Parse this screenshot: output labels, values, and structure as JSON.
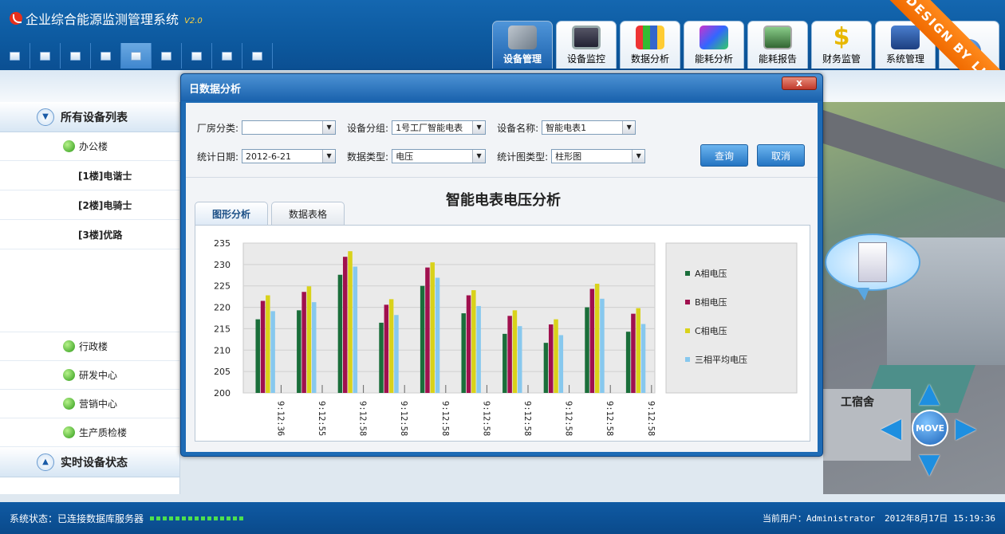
{
  "app": {
    "title": "企业综合能源监测管理系统",
    "version": "V2.0",
    "watermark": "DESIGN BY LJW"
  },
  "toolbar": {
    "buttons": [
      "toolbar-btn-1",
      "toolbar-btn-2",
      "toolbar-btn-3",
      "toolbar-btn-4",
      "toolbar-btn-5",
      "toolbar-btn-6",
      "toolbar-btn-7",
      "toolbar-btn-8",
      "toolbar-btn-9"
    ]
  },
  "nav": {
    "tabs": [
      {
        "label": "设备管理",
        "icon": "device-manage-icon",
        "active": true
      },
      {
        "label": "设备监控",
        "icon": "monitor-icon"
      },
      {
        "label": "数据分析",
        "icon": "data-analysis-icon"
      },
      {
        "label": "能耗分析",
        "icon": "energy-analysis-icon"
      },
      {
        "label": "能耗报告",
        "icon": "energy-report-icon"
      },
      {
        "label": "财务监管",
        "icon": "finance-icon"
      },
      {
        "label": "系统管理",
        "icon": "system-icon"
      },
      {
        "label": "",
        "icon": "help-icon"
      }
    ]
  },
  "sidebar": {
    "header_all": "所有设备列表",
    "groups": [
      {
        "label": "办公楼",
        "items": [
          "[1楼]电谐士",
          "[2楼]电骑士",
          "[3楼]优路"
        ]
      },
      {
        "label": "行政楼"
      },
      {
        "label": "研发中心"
      },
      {
        "label": "营销中心"
      },
      {
        "label": "生产质检楼"
      }
    ],
    "header_realtime": "实时设备状态"
  },
  "dialog": {
    "title": "日数据分析",
    "close_label": "x",
    "filters": {
      "factory": {
        "label": "厂房分类:",
        "value": ""
      },
      "device_group": {
        "label": "设备分组:",
        "value": "1号工厂智能电表"
      },
      "device_name": {
        "label": "设备名称:",
        "value": "智能电表1"
      },
      "date": {
        "label": "统计日期:",
        "value": "2012-6-21"
      },
      "data_type": {
        "label": "数据类型:",
        "value": "电压"
      },
      "chart_type": {
        "label": "统计图类型:",
        "value": "柱形图"
      }
    },
    "query_button": "查询",
    "cancel_button": "取消",
    "tabs": [
      "图形分析",
      "数据表格"
    ]
  },
  "map": {
    "dorm_label": "工宿舍",
    "move_label": "MOVE"
  },
  "status": {
    "label": "系统状态：已连接数据库服务器",
    "user": "当前用户：Administrator",
    "datetime": "2012年8月17日 15:19:36"
  },
  "colors": {
    "phaseA": "#1a6e3a",
    "phaseB": "#a0104e",
    "phaseC": "#d9d21a",
    "avg": "#87c8ee"
  },
  "chart_data": {
    "type": "bar",
    "title": "智能电表电压分析",
    "categories": [
      "9:12:36",
      "9:12:55",
      "9:12:58",
      "9:12:58",
      "9:12:58",
      "9:12:58",
      "9:12:58",
      "9:12:58",
      "9:12:58",
      "9:12:58"
    ],
    "ylim": [
      200,
      235
    ],
    "yticks": [
      200,
      205,
      210,
      215,
      220,
      225,
      230,
      235
    ],
    "legend_position": "right",
    "series": [
      {
        "name": "A相电压",
        "color": "#1a6e3a",
        "values": [
          217.2,
          219.3,
          227.6,
          216.4,
          225.0,
          218.6,
          213.8,
          211.7,
          220.0,
          214.3
        ]
      },
      {
        "name": "B相电压",
        "color": "#a0104e",
        "values": [
          221.5,
          223.6,
          231.8,
          220.6,
          229.3,
          222.8,
          218.0,
          216.0,
          224.3,
          218.5
        ]
      },
      {
        "name": "C相电压",
        "color": "#d9d21a",
        "values": [
          222.8,
          224.9,
          233.1,
          221.9,
          230.5,
          224.0,
          219.3,
          217.2,
          225.5,
          219.8
        ]
      },
      {
        "name": "三相平均电压",
        "color": "#87c8ee",
        "values": [
          219.1,
          221.2,
          229.5,
          218.2,
          226.9,
          220.3,
          215.6,
          213.5,
          222.0,
          216.1
        ]
      }
    ]
  }
}
